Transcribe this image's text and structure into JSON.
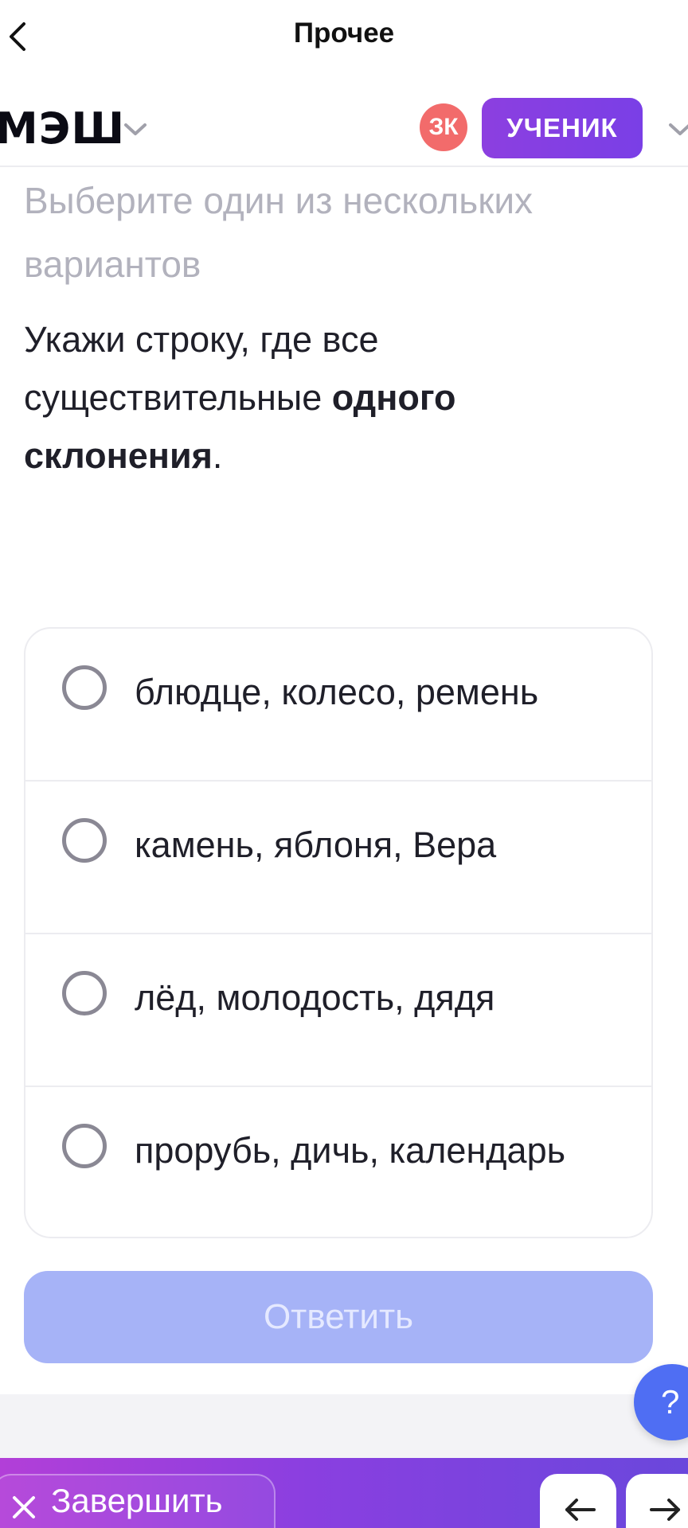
{
  "nav": {
    "title": "Прочее"
  },
  "header": {
    "logo": "МЭШ",
    "avatar_initials": "ЗК",
    "role": "УЧЕНИК"
  },
  "task": {
    "instruction": "Выберите один из нескольких вариантов",
    "question_part1": "Укажи строку, где все существительные ",
    "question_bold": "одного склонения",
    "question_end": "."
  },
  "options": [
    {
      "label": "блюдце, колесо, ремень"
    },
    {
      "label": "камень, яблоня, Вера"
    },
    {
      "label": "лёд, молодость, дядя"
    },
    {
      "label": "прорубь, дичь, календарь"
    }
  ],
  "actions": {
    "submit_label": "Ответить",
    "help_label": "?",
    "finish_label": "Завершить"
  },
  "colors": {
    "accent_purple": "#8c3fe0",
    "submit_disabled": "#a6b3f7",
    "help_blue": "#4f6ef3",
    "avatar_red": "#f26b6b"
  },
  "icons": {
    "back": "chevron-left-icon",
    "dropdown": "chevron-down-icon",
    "finish": "close-icon",
    "prev": "arrow-left-icon",
    "next": "arrow-right-icon"
  }
}
